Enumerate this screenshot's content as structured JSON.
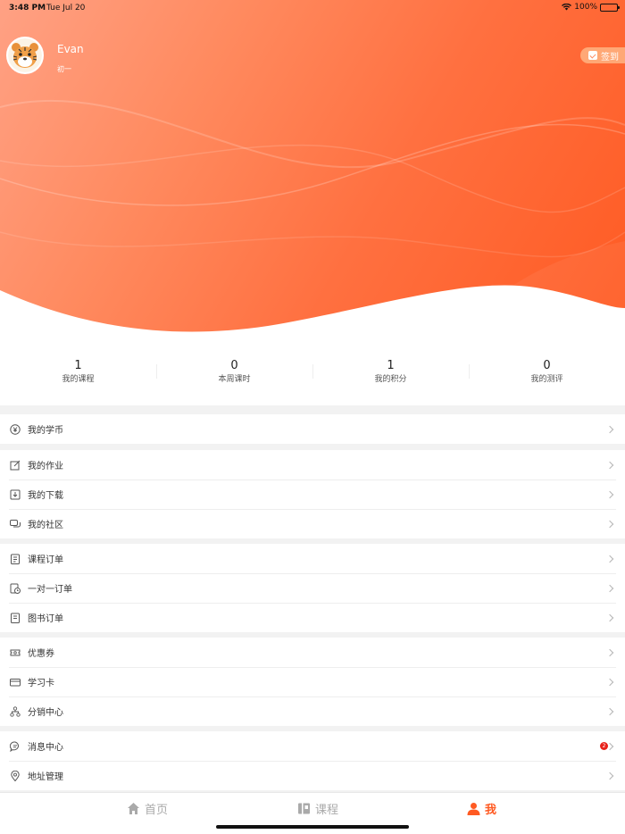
{
  "status_bar": {
    "time": "3:48 PM",
    "date": "Tue Jul 20",
    "battery": "100%"
  },
  "profile": {
    "name": "Evan",
    "grade": "初一",
    "checkin_label": "签到"
  },
  "stats": [
    {
      "value": "1",
      "label": "我的课程"
    },
    {
      "value": "0",
      "label": "本周课时"
    },
    {
      "value": "1",
      "label": "我的积分"
    },
    {
      "value": "0",
      "label": "我的测评"
    }
  ],
  "menu_groups": [
    [
      {
        "label": "我的学币",
        "icon": "coin-icon"
      }
    ],
    [
      {
        "label": "我的作业",
        "icon": "homework-icon"
      },
      {
        "label": "我的下载",
        "icon": "download-icon"
      },
      {
        "label": "我的社区",
        "icon": "community-icon"
      }
    ],
    [
      {
        "label": "课程订单",
        "icon": "order-icon"
      },
      {
        "label": "一对一订单",
        "icon": "one-on-one-order-icon"
      },
      {
        "label": "图书订单",
        "icon": "book-order-icon"
      }
    ],
    [
      {
        "label": "优惠券",
        "icon": "coupon-icon"
      },
      {
        "label": "学习卡",
        "icon": "card-icon"
      },
      {
        "label": "分销中心",
        "icon": "distribution-icon"
      }
    ],
    [
      {
        "label": "消息中心",
        "icon": "message-icon",
        "badge": "2"
      },
      {
        "label": "地址管理",
        "icon": "location-icon"
      }
    ]
  ],
  "tabbar": [
    {
      "label": "首页",
      "icon": "home-icon",
      "active": false
    },
    {
      "label": "课程",
      "icon": "course-icon",
      "active": false
    },
    {
      "label": "我",
      "icon": "user-icon",
      "active": true
    }
  ],
  "colors": {
    "accent": "#ff5a22",
    "badge": "#e8221b",
    "gradient_start": "#ffa184",
    "gradient_end": "#ff5a22"
  }
}
